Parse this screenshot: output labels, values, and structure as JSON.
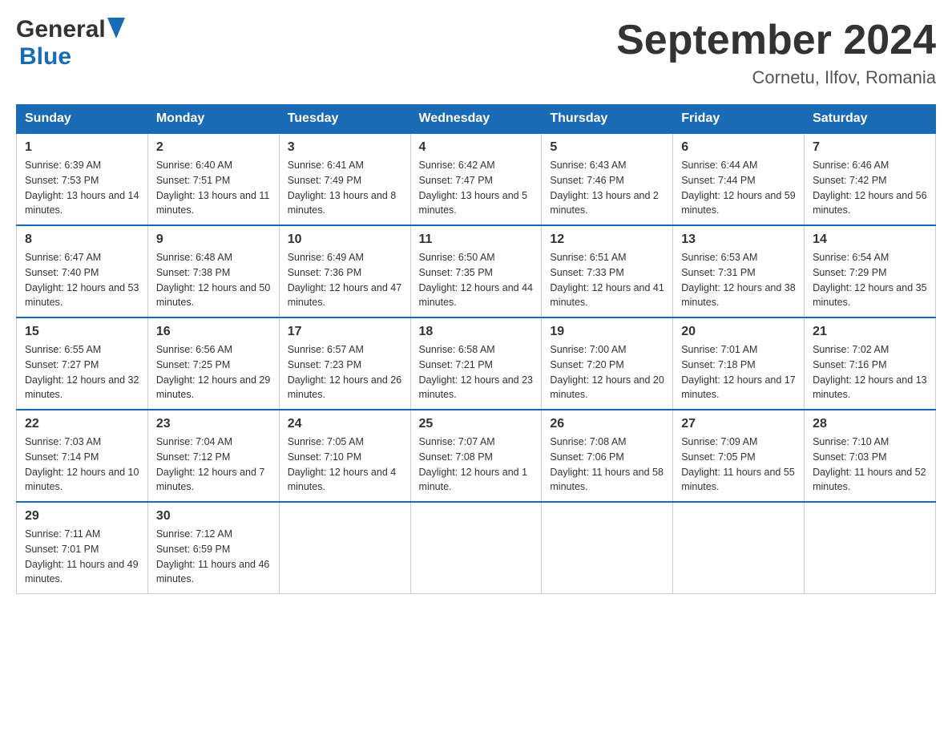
{
  "header": {
    "logo_general": "General",
    "logo_blue": "Blue",
    "title": "September 2024",
    "subtitle": "Cornetu, Ilfov, Romania"
  },
  "weekdays": [
    "Sunday",
    "Monday",
    "Tuesday",
    "Wednesday",
    "Thursday",
    "Friday",
    "Saturday"
  ],
  "weeks": [
    [
      {
        "day": "1",
        "sunrise": "Sunrise: 6:39 AM",
        "sunset": "Sunset: 7:53 PM",
        "daylight": "Daylight: 13 hours and 14 minutes."
      },
      {
        "day": "2",
        "sunrise": "Sunrise: 6:40 AM",
        "sunset": "Sunset: 7:51 PM",
        "daylight": "Daylight: 13 hours and 11 minutes."
      },
      {
        "day": "3",
        "sunrise": "Sunrise: 6:41 AM",
        "sunset": "Sunset: 7:49 PM",
        "daylight": "Daylight: 13 hours and 8 minutes."
      },
      {
        "day": "4",
        "sunrise": "Sunrise: 6:42 AM",
        "sunset": "Sunset: 7:47 PM",
        "daylight": "Daylight: 13 hours and 5 minutes."
      },
      {
        "day": "5",
        "sunrise": "Sunrise: 6:43 AM",
        "sunset": "Sunset: 7:46 PM",
        "daylight": "Daylight: 13 hours and 2 minutes."
      },
      {
        "day": "6",
        "sunrise": "Sunrise: 6:44 AM",
        "sunset": "Sunset: 7:44 PM",
        "daylight": "Daylight: 12 hours and 59 minutes."
      },
      {
        "day": "7",
        "sunrise": "Sunrise: 6:46 AM",
        "sunset": "Sunset: 7:42 PM",
        "daylight": "Daylight: 12 hours and 56 minutes."
      }
    ],
    [
      {
        "day": "8",
        "sunrise": "Sunrise: 6:47 AM",
        "sunset": "Sunset: 7:40 PM",
        "daylight": "Daylight: 12 hours and 53 minutes."
      },
      {
        "day": "9",
        "sunrise": "Sunrise: 6:48 AM",
        "sunset": "Sunset: 7:38 PM",
        "daylight": "Daylight: 12 hours and 50 minutes."
      },
      {
        "day": "10",
        "sunrise": "Sunrise: 6:49 AM",
        "sunset": "Sunset: 7:36 PM",
        "daylight": "Daylight: 12 hours and 47 minutes."
      },
      {
        "day": "11",
        "sunrise": "Sunrise: 6:50 AM",
        "sunset": "Sunset: 7:35 PM",
        "daylight": "Daylight: 12 hours and 44 minutes."
      },
      {
        "day": "12",
        "sunrise": "Sunrise: 6:51 AM",
        "sunset": "Sunset: 7:33 PM",
        "daylight": "Daylight: 12 hours and 41 minutes."
      },
      {
        "day": "13",
        "sunrise": "Sunrise: 6:53 AM",
        "sunset": "Sunset: 7:31 PM",
        "daylight": "Daylight: 12 hours and 38 minutes."
      },
      {
        "day": "14",
        "sunrise": "Sunrise: 6:54 AM",
        "sunset": "Sunset: 7:29 PM",
        "daylight": "Daylight: 12 hours and 35 minutes."
      }
    ],
    [
      {
        "day": "15",
        "sunrise": "Sunrise: 6:55 AM",
        "sunset": "Sunset: 7:27 PM",
        "daylight": "Daylight: 12 hours and 32 minutes."
      },
      {
        "day": "16",
        "sunrise": "Sunrise: 6:56 AM",
        "sunset": "Sunset: 7:25 PM",
        "daylight": "Daylight: 12 hours and 29 minutes."
      },
      {
        "day": "17",
        "sunrise": "Sunrise: 6:57 AM",
        "sunset": "Sunset: 7:23 PM",
        "daylight": "Daylight: 12 hours and 26 minutes."
      },
      {
        "day": "18",
        "sunrise": "Sunrise: 6:58 AM",
        "sunset": "Sunset: 7:21 PM",
        "daylight": "Daylight: 12 hours and 23 minutes."
      },
      {
        "day": "19",
        "sunrise": "Sunrise: 7:00 AM",
        "sunset": "Sunset: 7:20 PM",
        "daylight": "Daylight: 12 hours and 20 minutes."
      },
      {
        "day": "20",
        "sunrise": "Sunrise: 7:01 AM",
        "sunset": "Sunset: 7:18 PM",
        "daylight": "Daylight: 12 hours and 17 minutes."
      },
      {
        "day": "21",
        "sunrise": "Sunrise: 7:02 AM",
        "sunset": "Sunset: 7:16 PM",
        "daylight": "Daylight: 12 hours and 13 minutes."
      }
    ],
    [
      {
        "day": "22",
        "sunrise": "Sunrise: 7:03 AM",
        "sunset": "Sunset: 7:14 PM",
        "daylight": "Daylight: 12 hours and 10 minutes."
      },
      {
        "day": "23",
        "sunrise": "Sunrise: 7:04 AM",
        "sunset": "Sunset: 7:12 PM",
        "daylight": "Daylight: 12 hours and 7 minutes."
      },
      {
        "day": "24",
        "sunrise": "Sunrise: 7:05 AM",
        "sunset": "Sunset: 7:10 PM",
        "daylight": "Daylight: 12 hours and 4 minutes."
      },
      {
        "day": "25",
        "sunrise": "Sunrise: 7:07 AM",
        "sunset": "Sunset: 7:08 PM",
        "daylight": "Daylight: 12 hours and 1 minute."
      },
      {
        "day": "26",
        "sunrise": "Sunrise: 7:08 AM",
        "sunset": "Sunset: 7:06 PM",
        "daylight": "Daylight: 11 hours and 58 minutes."
      },
      {
        "day": "27",
        "sunrise": "Sunrise: 7:09 AM",
        "sunset": "Sunset: 7:05 PM",
        "daylight": "Daylight: 11 hours and 55 minutes."
      },
      {
        "day": "28",
        "sunrise": "Sunrise: 7:10 AM",
        "sunset": "Sunset: 7:03 PM",
        "daylight": "Daylight: 11 hours and 52 minutes."
      }
    ],
    [
      {
        "day": "29",
        "sunrise": "Sunrise: 7:11 AM",
        "sunset": "Sunset: 7:01 PM",
        "daylight": "Daylight: 11 hours and 49 minutes."
      },
      {
        "day": "30",
        "sunrise": "Sunrise: 7:12 AM",
        "sunset": "Sunset: 6:59 PM",
        "daylight": "Daylight: 11 hours and 46 minutes."
      },
      null,
      null,
      null,
      null,
      null
    ]
  ]
}
